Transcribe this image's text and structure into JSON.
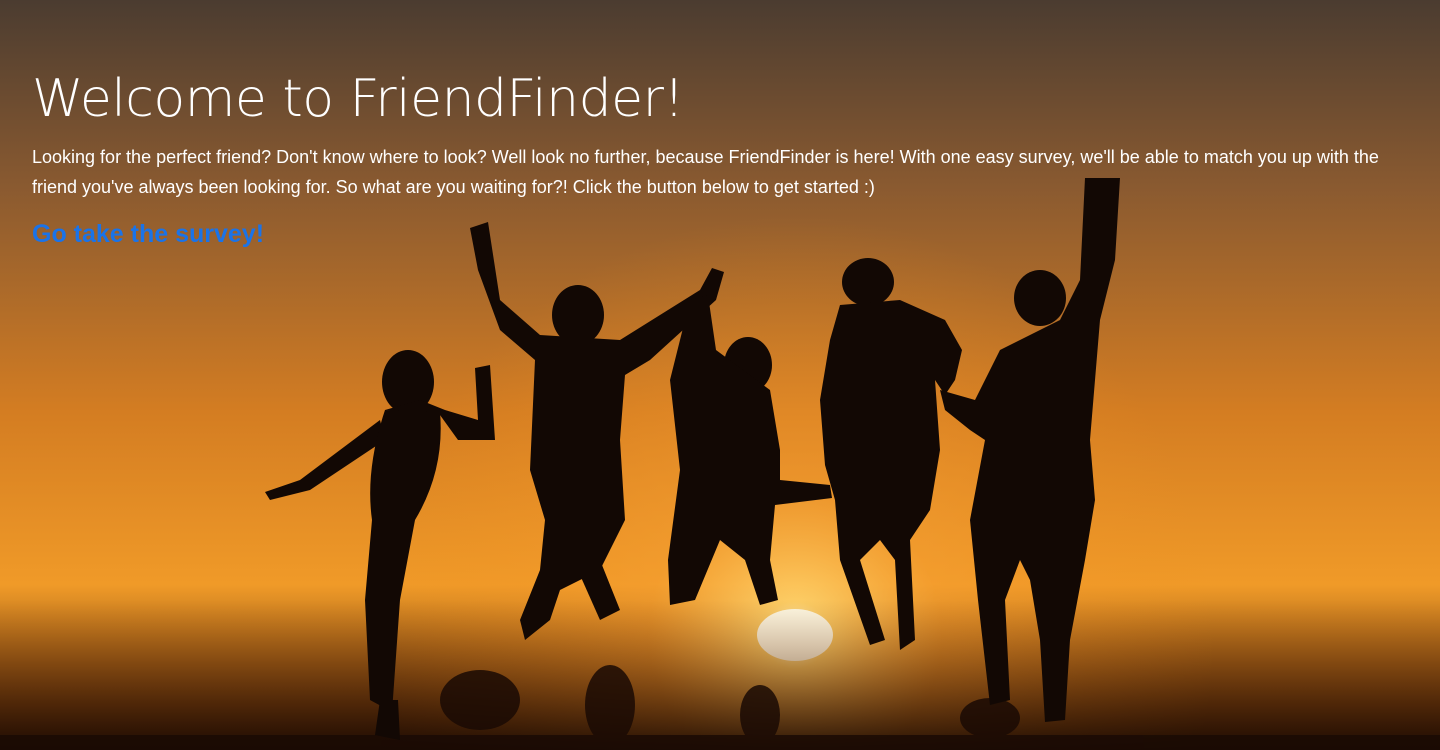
{
  "header": {
    "title": "Welcome to FriendFinder!",
    "description": "Looking for the perfect friend? Don't know where to look? Well look no further, because FriendFinder is here! With one easy survey, we'll be able to match you up with the friend you've always been looking for. So what are you waiting for?! Click the button below to get started :)",
    "survey_link_label": "Go take the survey!"
  },
  "colors": {
    "title": "#ffffff",
    "text": "#ffffff",
    "link": "#1a73e8",
    "sky_top": "#4a3a2c",
    "sky_mid": "#e08a26",
    "sun": "#fff4c0"
  }
}
